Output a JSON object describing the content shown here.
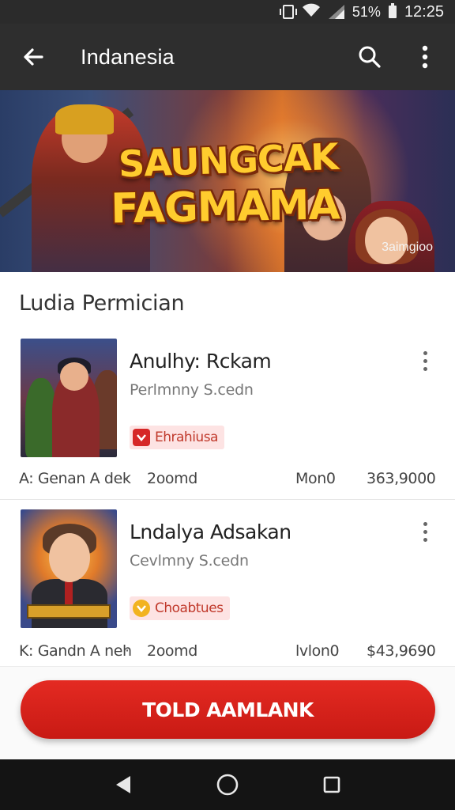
{
  "status_bar": {
    "battery_percent": "51%",
    "time": "12:25"
  },
  "app_bar": {
    "title": "Indanesia",
    "icons": {
      "back": "arrow-left-icon",
      "search": "search-icon",
      "more": "more-vertical-icon"
    }
  },
  "banner": {
    "title_line1": "SAUNGCAK",
    "title_line2": "FAGMAMA",
    "credit": "3aimgioo"
  },
  "section": {
    "title": "Ludia Permician"
  },
  "games": [
    {
      "title": "Anulhy: Rckam",
      "subtitle": "Perlmnny S.cedn",
      "badge": "Ehrahiusa",
      "meta_left": "A: Genan A dek",
      "meta_dot": "·",
      "meta_size": "2oomd",
      "meta_mid": "Mon0",
      "meta_price": "363,9000"
    },
    {
      "title": "Lndalya Adsakan",
      "subtitle": "Cevlmny S.cedn",
      "badge": "Choabtues",
      "meta_left": "K: Gandn A neh",
      "meta_dot": "·",
      "meta_size": "2oomd",
      "meta_mid": "lvlon0",
      "meta_price": "$43,9690"
    }
  ],
  "cta": {
    "label": "TOLD AAMLANK"
  },
  "nav": {
    "back": "triangle-back-icon",
    "home": "circle-home-icon",
    "recents": "square-recents-icon"
  },
  "colors": {
    "accent": "#d62420",
    "app_bar": "#2e2e2e",
    "badge_bg": "#fde3e3"
  }
}
